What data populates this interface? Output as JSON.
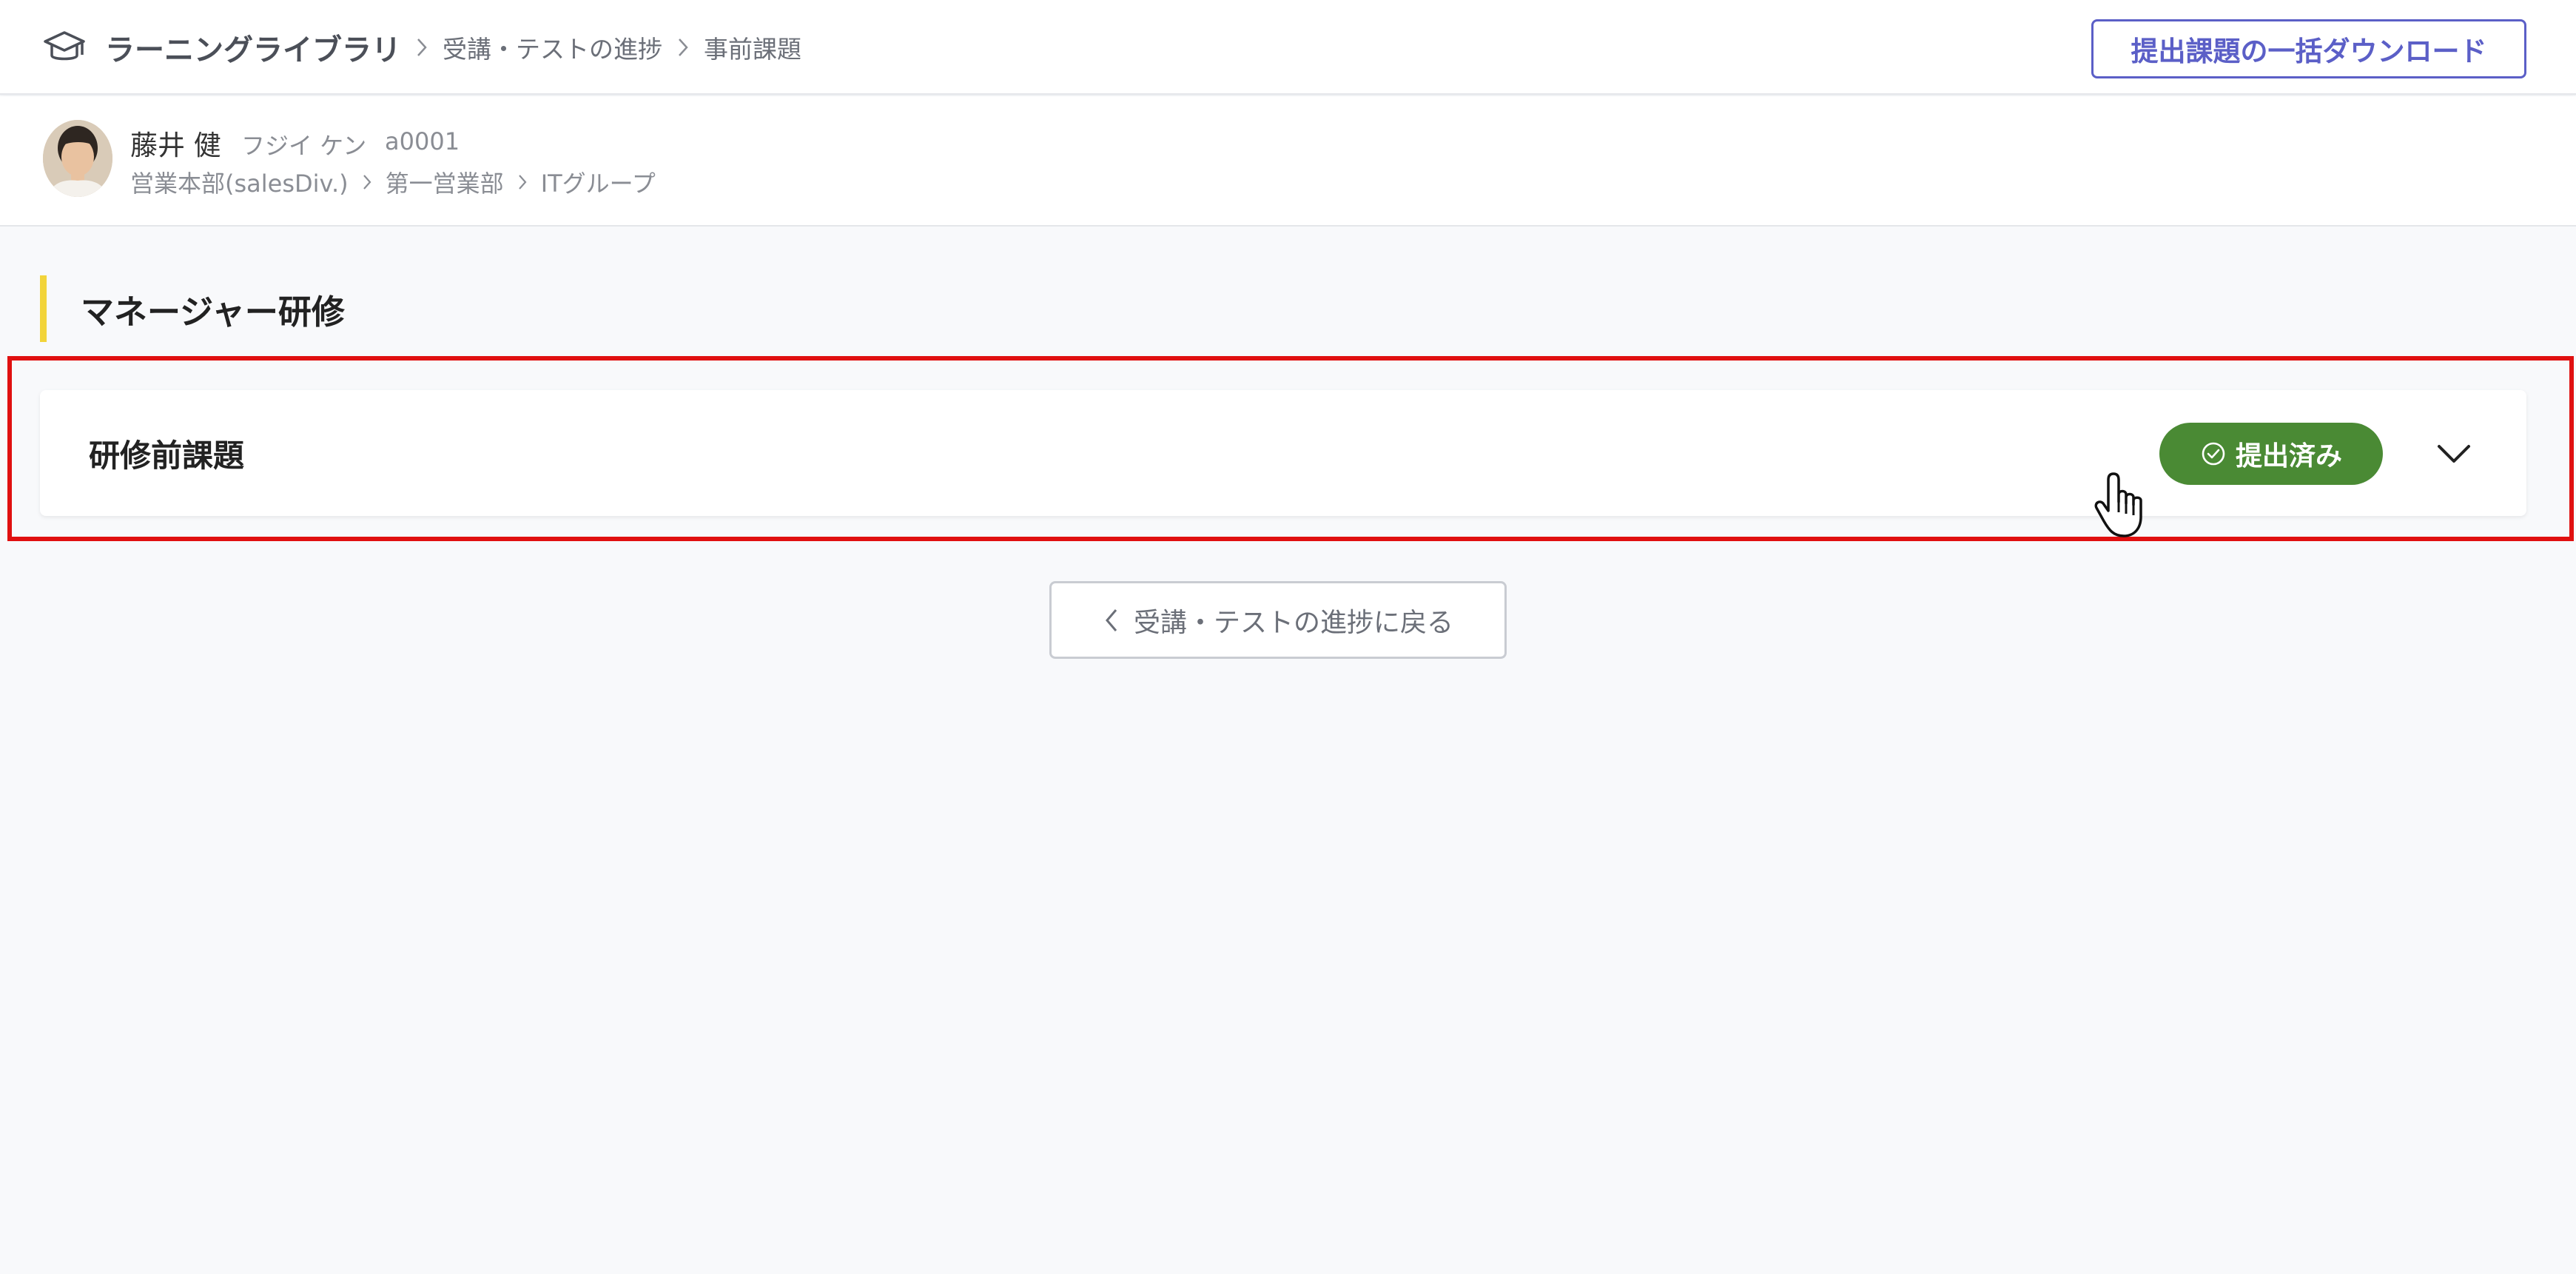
{
  "header": {
    "app_name": "ラーニングライブラリ",
    "breadcrumb": [
      "受講・テストの進捗",
      "事前課題"
    ],
    "download_label": "提出課題の一括ダウンロード"
  },
  "user": {
    "name": "藤井 健",
    "kana": "フジイ ケン",
    "id": "a0001",
    "org_path": [
      "営業本部(salesDiv.)",
      "第一営業部",
      "ITグループ"
    ]
  },
  "section": {
    "title": "マネージャー研修"
  },
  "assignment": {
    "title": "研修前課題",
    "status": "提出済み"
  },
  "back_button": {
    "label": "受講・テストの進捗に戻る"
  },
  "colors": {
    "accent": "#5b5fc7",
    "status_submitted": "#4a8a34",
    "section_marker": "#f2d43a",
    "highlight": "#e01010"
  }
}
